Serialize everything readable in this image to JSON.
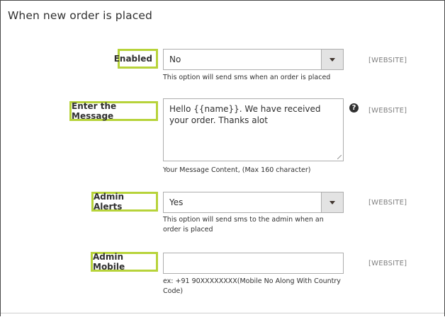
{
  "section": {
    "title": "When new order is placed"
  },
  "fields": {
    "enabled": {
      "label": "Enabled",
      "value": "No",
      "note": "This option will send sms when an order is placed",
      "scope": "[WEBSITE]"
    },
    "message": {
      "label": "Enter the Message",
      "value": "Hello {{name}}. We have received your order. Thanks alot",
      "note": "Your Message Content, (Max 160 character)",
      "help_glyph": "?",
      "scope": "[WEBSITE]"
    },
    "admin_alerts": {
      "label": "Admin Alerts",
      "value": "Yes",
      "note": "This option will send sms to the admin when an order is placed",
      "scope": "[WEBSITE]"
    },
    "admin_mobile": {
      "label": "Admin Mobile",
      "value": "",
      "note": "ex: +91 90XXXXXXXX(Mobile No Along With Country Code)",
      "scope": "[WEBSITE]"
    }
  },
  "colors": {
    "highlight": "#b7d33a",
    "scope_text": "#808080"
  },
  "icons": {
    "help": "question-circle-icon",
    "dropdown": "chevron-down-icon"
  }
}
